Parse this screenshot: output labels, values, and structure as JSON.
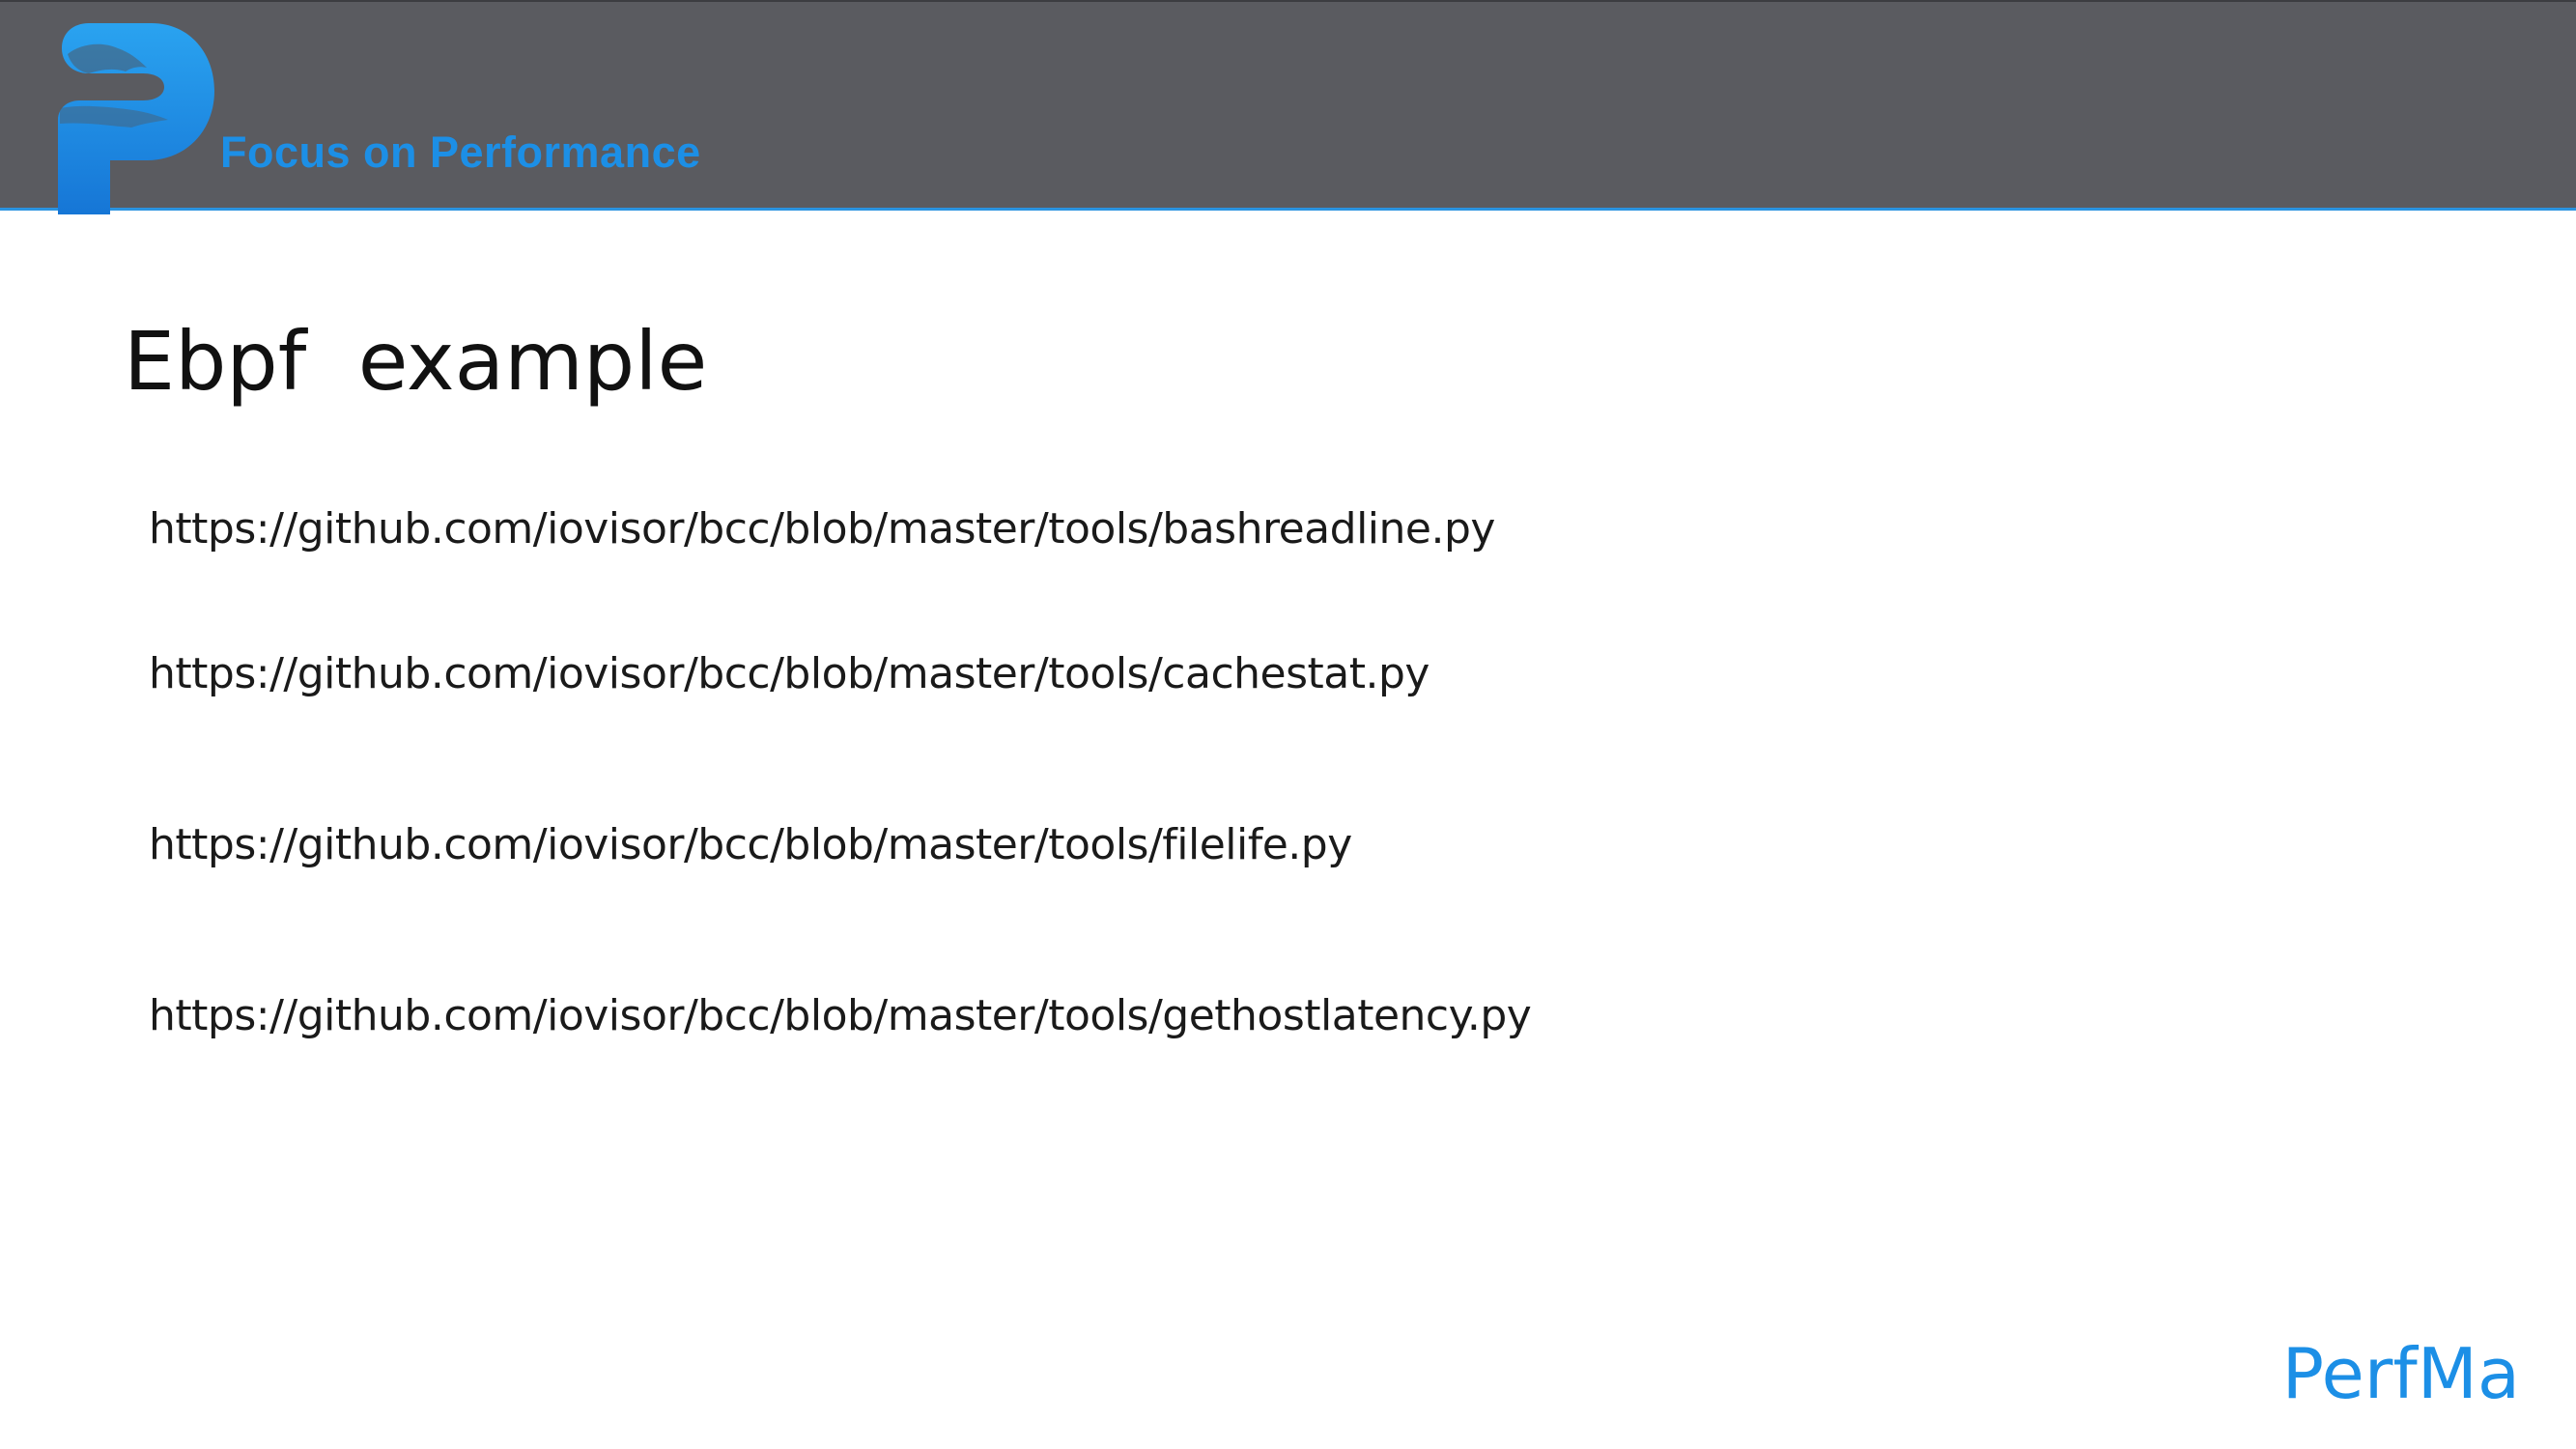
{
  "header": {
    "tagline": "Focus on Performance",
    "logo_icon": "perfma-p-logo-icon",
    "accent_color": "#1c8fe6",
    "bar_color": "#5a5b60"
  },
  "slide": {
    "title": "Ebpf  example",
    "links": [
      "https://github.com/iovisor/bcc/blob/master/tools/bashreadline.py",
      "https://github.com/iovisor/bcc/blob/master/tools/cachestat.py",
      "https://github.com/iovisor/bcc/blob/master/tools/filelife.py",
      "https://github.com/iovisor/bcc/blob/master/tools/gethostlatency.py"
    ]
  },
  "footer": {
    "brand": "PerfMa"
  }
}
